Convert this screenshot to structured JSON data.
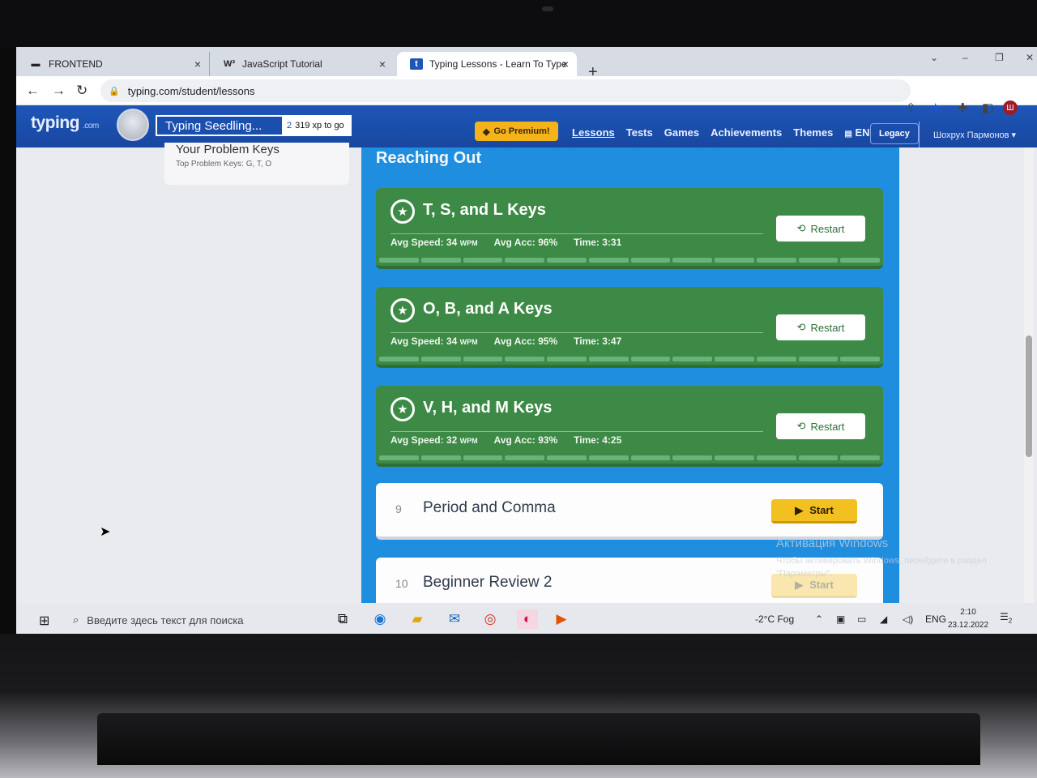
{
  "browser": {
    "tabs": [
      {
        "label": "FRONTEND",
        "favicon": "folder-icon"
      },
      {
        "label": "JavaScript Tutorial",
        "favicon": "W³"
      },
      {
        "label": "Typing Lessons - Learn To Type A",
        "favicon": "t"
      }
    ],
    "url": "typing.com/student/lessons"
  },
  "header": {
    "logo": "typing",
    "logo_suffix": ".com",
    "rank_name": "Typing Seedling...",
    "xp_prefix": "2",
    "xp_text": "319 xp to go",
    "premium_label": "Go Premium!",
    "nav": [
      "Lessons",
      "Tests",
      "Games",
      "Achievements",
      "Themes"
    ],
    "language": "EN",
    "legacy_label": "Legacy",
    "user_name": "Шохрух Пармонов"
  },
  "sidebar": {
    "problem_title": "Your Problem Keys",
    "problem_sub": "Top Problem Keys: G, T, O"
  },
  "main": {
    "section_title": "Reaching Out",
    "completed_lessons": [
      {
        "name": "T, S, and L Keys",
        "speed_label": "Avg Speed:",
        "speed": "34",
        "speed_unit": "WPM",
        "acc_label": "Avg Acc:",
        "acc": "96%",
        "time_label": "Time:",
        "time": "3:31",
        "button": "Restart"
      },
      {
        "name": "O, B, and A Keys",
        "speed_label": "Avg Speed:",
        "speed": "34",
        "speed_unit": "WPM",
        "acc_label": "Avg Acc:",
        "acc": "95%",
        "time_label": "Time:",
        "time": "3:47",
        "button": "Restart"
      },
      {
        "name": "V, H, and M Keys",
        "speed_label": "Avg Speed:",
        "speed": "32",
        "speed_unit": "WPM",
        "acc_label": "Avg Acc:",
        "acc": "93%",
        "time_label": "Time:",
        "time": "4:25",
        "button": "Restart"
      }
    ],
    "upcoming_lessons": [
      {
        "number": "9",
        "name": "Period and Comma",
        "button": "Start"
      },
      {
        "number": "10",
        "name": "Beginner Review 2",
        "button": "Start"
      }
    ]
  },
  "watermark": {
    "title": "Активация Windows",
    "body": "Чтобы активировать Windows, перейдите в раздел \"Параметры\"."
  },
  "taskbar": {
    "search_placeholder": "Введите здесь текст для поиска",
    "weather": "-2°C  Fog",
    "lang": "ENG",
    "time": "2:10",
    "date": "23.12.2022",
    "notification_count": "2"
  },
  "colors": {
    "header_blue": "#1e56b8",
    "lessons_blue": "#1f8edf",
    "completed_green": "#3c8a45",
    "start_yellow": "#f2c021",
    "premium_orange": "#f4b21b"
  }
}
